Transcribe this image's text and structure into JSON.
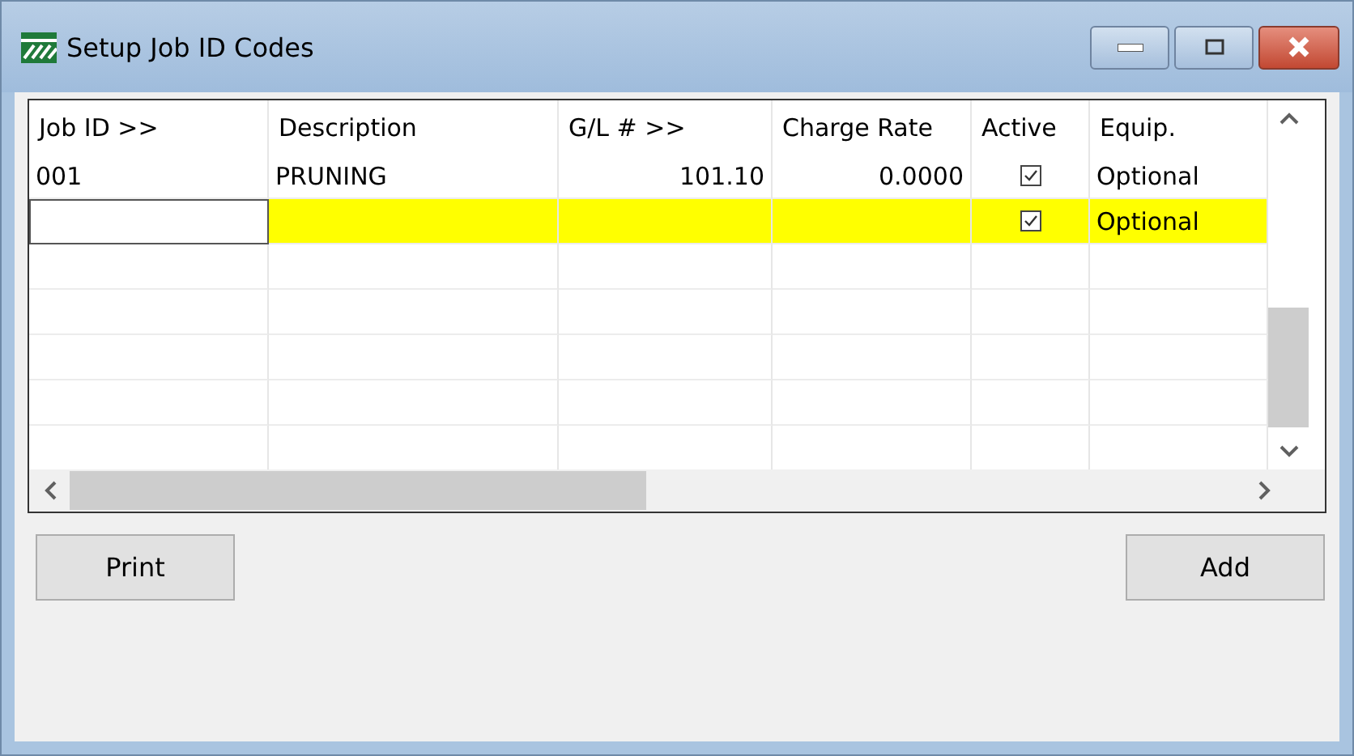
{
  "window": {
    "title": "Setup Job ID Codes"
  },
  "table": {
    "columns": [
      "Job ID >>",
      "Description",
      "G/L # >>",
      "Charge Rate",
      "Active",
      "Equip."
    ],
    "rows": [
      {
        "selected": false,
        "job_id": "001",
        "description": "PRUNING",
        "gl": "101.10",
        "charge_rate": "0.0000",
        "active": true,
        "equip": "Optional"
      },
      {
        "selected": true,
        "job_id": "",
        "description": "",
        "gl": "",
        "charge_rate": "",
        "active": true,
        "equip": "Optional"
      }
    ]
  },
  "buttons": [
    "Print",
    "Add"
  ]
}
